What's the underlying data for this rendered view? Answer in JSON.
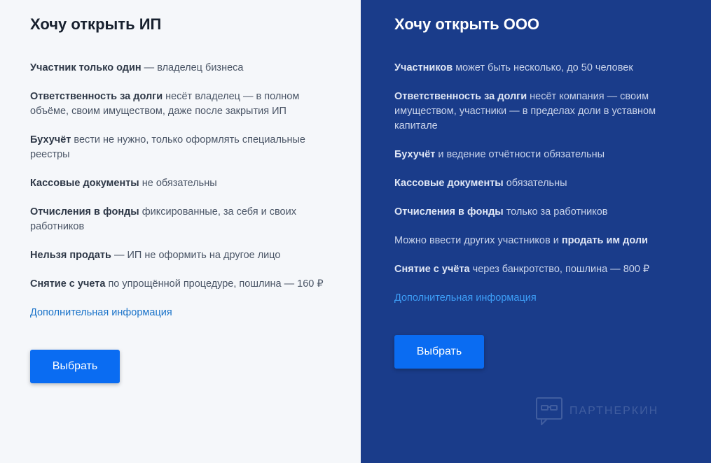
{
  "ip": {
    "title": "Хочу открыть ИП",
    "features": [
      {
        "bold": "Участник только один",
        "text": " — владелец бизнеса"
      },
      {
        "bold": "Ответственность за долги",
        "text": " несёт владелец — в полном объёме, своим имуществом, даже после закрытия ИП"
      },
      {
        "bold": "Бухучёт",
        "text": " вести не нужно, только оформлять специальные реестры"
      },
      {
        "bold": "Кассовые документы",
        "text": " не обязательны"
      },
      {
        "bold": "Отчисления в фонды",
        "text": " фиксированные, за себя и своих работников"
      },
      {
        "bold": "Нельзя продать",
        "text": " — ИП не оформить на другое лицо"
      },
      {
        "bold": "Снятие с учета",
        "text": " по упрощённой процедуре, пошлина — 160 ₽"
      }
    ],
    "more_link": "Дополнительная информация",
    "button": "Выбрать"
  },
  "ooo": {
    "title": "Хочу открыть ООО",
    "features": [
      {
        "bold": "Участников",
        "text": " может быть несколько, до 50 человек"
      },
      {
        "bold": "Ответственность за долги",
        "text": " несёт компания — своим имуществом, участники — в пределах доли в уставном капитале"
      },
      {
        "bold": "Бухучёт",
        "text": " и ведение отчётности обязательны"
      },
      {
        "bold": "Кассовые документы",
        "text": " обязательны"
      },
      {
        "bold": "Отчисления в фонды",
        "text": " только за работников"
      },
      {
        "text_before": "Можно ввести других участников и ",
        "bold": "продать им доли"
      },
      {
        "bold": "Снятие с учёта",
        "text": " через банкротство, пошлина — 800 ₽"
      }
    ],
    "more_link": "Дополнительная информация",
    "button": "Выбрать"
  },
  "watermark": {
    "text": "ПАРТНЕРКИН",
    "icon": "partnerkin-logo-icon"
  },
  "colors": {
    "left_bg": "#f5f7fa",
    "right_bg": "#1a3c8a",
    "button": "#0a6cf2",
    "link_left": "#1a73c9",
    "link_right": "#3d9ef7"
  }
}
